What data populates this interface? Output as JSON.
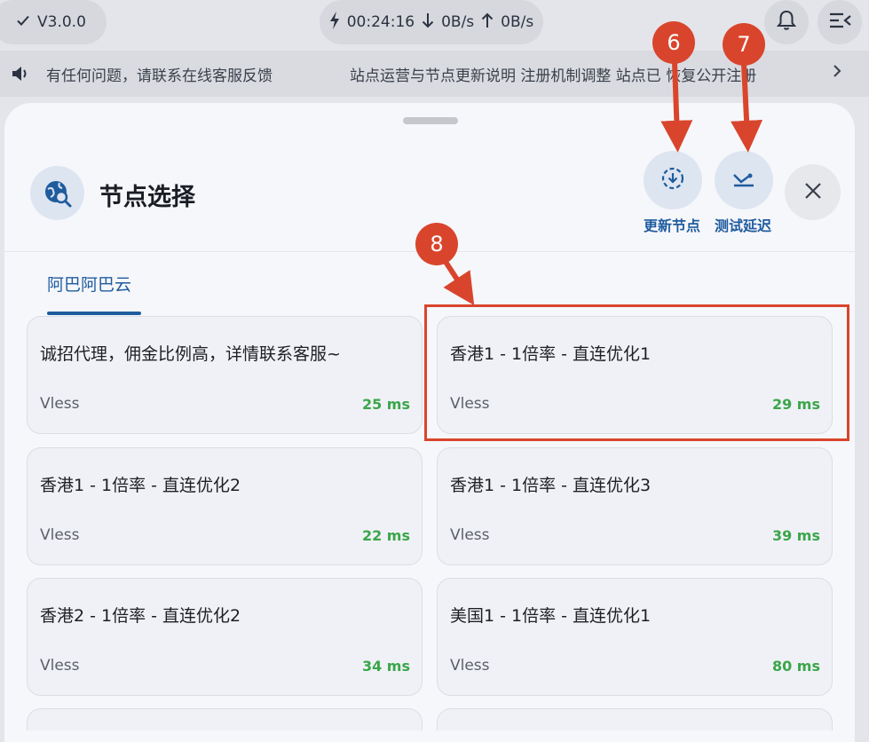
{
  "status_bar": {
    "version": "V3.0.0",
    "timer": "00:24:16",
    "download_speed": "0B/s",
    "upload_speed": "0B/s"
  },
  "notice": {
    "text_left": "有任何问题，请联系在线客服反馈",
    "text_right": "站点运营与节点更新说明 注册机制调整 站点已 恢复公开注册"
  },
  "sheet": {
    "title": "节点选择",
    "update_label": "更新节点",
    "test_label": "测试延迟",
    "tab_label": "阿巴阿巴云"
  },
  "nodes": [
    {
      "name": "诚招代理，佣金比例高，详情联系客服~",
      "protocol": "Vless",
      "latency": "25 ms"
    },
    {
      "name": "香港1 - 1倍率 - 直连优化1",
      "protocol": "Vless",
      "latency": "29 ms"
    },
    {
      "name": "香港1 - 1倍率 - 直连优化2",
      "protocol": "Vless",
      "latency": "22 ms"
    },
    {
      "name": "香港1 - 1倍率 - 直连优化3",
      "protocol": "Vless",
      "latency": "39 ms"
    },
    {
      "name": "香港2 - 1倍率 - 直连优化2",
      "protocol": "Vless",
      "latency": "34 ms"
    },
    {
      "name": "美国1 - 1倍率 - 直连优化1",
      "protocol": "Vless",
      "latency": "80 ms"
    }
  ],
  "annotations": {
    "marker_6": "6",
    "marker_7": "7",
    "marker_8": "8"
  },
  "colors": {
    "accent": "#1f5c9e",
    "latency_good": "#3aa64a",
    "annotation": "#d9452c"
  },
  "icons": [
    "check-icon",
    "bolt-icon",
    "arrow-down-icon",
    "arrow-up-icon",
    "bell-icon",
    "menu-icon",
    "speaker-icon",
    "chevron-right-icon",
    "globe-search-icon",
    "download-circle-icon",
    "speed-test-icon",
    "close-icon"
  ]
}
